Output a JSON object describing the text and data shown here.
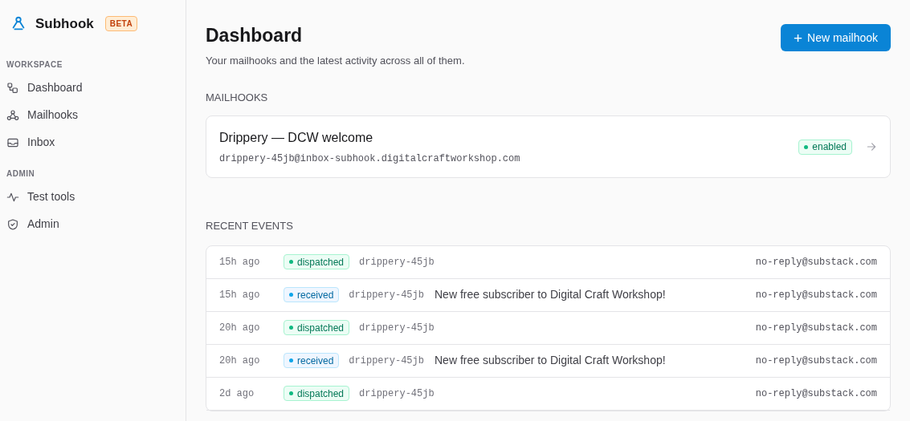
{
  "brand": {
    "name": "Subhook",
    "badge": "BETA"
  },
  "sidebar": {
    "sections": [
      {
        "title": "WORKSPACE",
        "items": [
          {
            "label": "Dashboard"
          },
          {
            "label": "Mailhooks"
          },
          {
            "label": "Inbox"
          }
        ]
      },
      {
        "title": "ADMIN",
        "items": [
          {
            "label": "Test tools"
          },
          {
            "label": "Admin"
          }
        ]
      }
    ]
  },
  "header": {
    "title": "Dashboard",
    "subtitle": "Your mailhooks and the latest activity across all of them.",
    "button": {
      "icon": "+",
      "label": "New mailhook"
    }
  },
  "mailhooks": {
    "title": "MAILHOOKS",
    "items": [
      {
        "name": "Drippery — DCW welcome",
        "address": "drippery-45jb@inbox-subhook.digitalcraftworkshop.com",
        "status": "enabled"
      }
    ]
  },
  "recent_events": {
    "title": "RECENT EVENTS",
    "rows": [
      {
        "time": "15h ago",
        "status": "dispatched",
        "hook": "drippery-45jb",
        "from": "no-reply@substack.com"
      },
      {
        "time": "15h ago",
        "status": "received",
        "hook": "drippery-45jb",
        "subject": "New free subscriber to Digital Craft Workshop!",
        "from": "no-reply@substack.com"
      },
      {
        "time": "20h ago",
        "status": "dispatched",
        "hook": "drippery-45jb",
        "from": "no-reply@substack.com"
      },
      {
        "time": "20h ago",
        "status": "received",
        "hook": "drippery-45jb",
        "subject": "New free subscriber to Digital Craft Workshop!",
        "from": "no-reply@substack.com"
      },
      {
        "time": "2d ago",
        "status": "dispatched",
        "hook": "drippery-45jb",
        "from": "no-reply@substack.com"
      }
    ]
  }
}
